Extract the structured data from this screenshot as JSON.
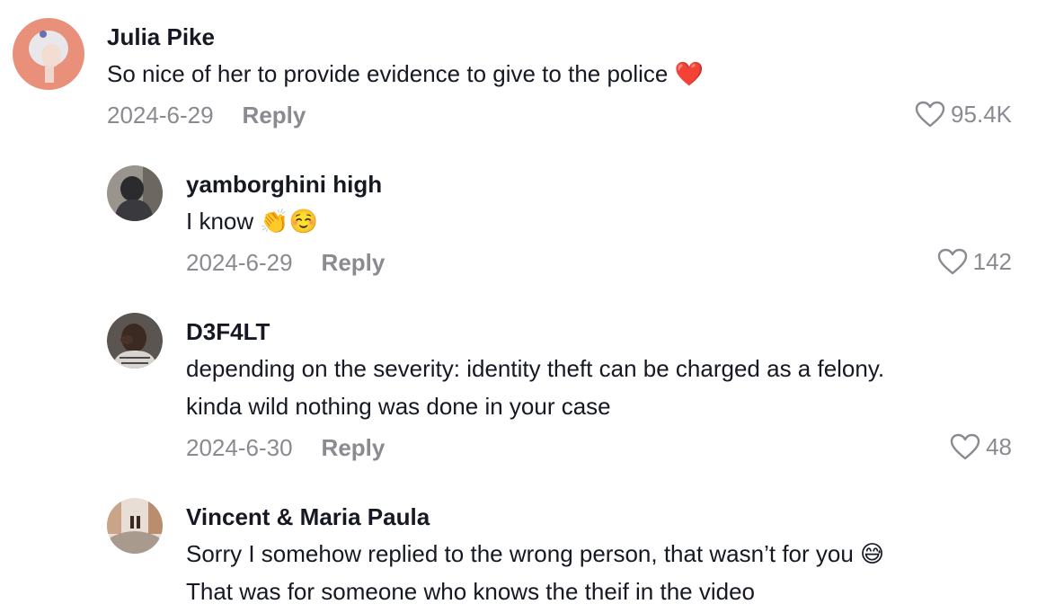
{
  "comments": [
    {
      "username": "Julia Pike",
      "text_lines": [
        "So nice of her to provide evidence to give to the police ❤️"
      ],
      "date": "2024-6-29",
      "reply_label": "Reply",
      "likes": "95.4K"
    },
    {
      "username": "yamborghini high",
      "text_lines": [
        "I know 👏☺️"
      ],
      "date": "2024-6-29",
      "reply_label": "Reply",
      "likes": "142"
    },
    {
      "username": "D3F4LT",
      "text_lines": [
        "depending on the severity: identity theft can be charged as a felony.",
        "kinda wild nothing was done in your case"
      ],
      "date": "2024-6-30",
      "reply_label": "Reply",
      "likes": "48"
    },
    {
      "username": "Vincent & Maria Paula",
      "text_lines": [
        "Sorry I somehow replied to the wrong person, that wasn’t for you 😅",
        "That was for someone who knows the theif in the video"
      ]
    }
  ],
  "icons": {
    "like": "heart-outline-icon"
  },
  "colors": {
    "text": "#161823",
    "secondary": "#8a8b91"
  }
}
